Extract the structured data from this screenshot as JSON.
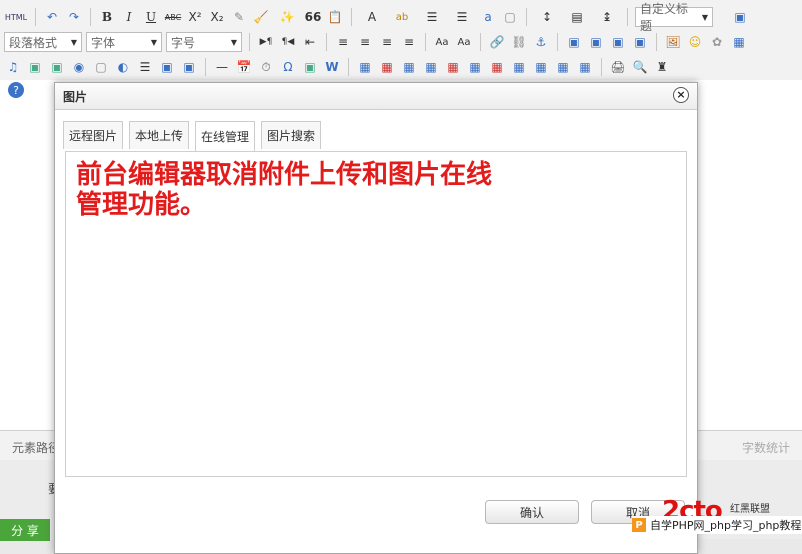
{
  "toolbar": {
    "row1": [
      "HTML",
      "↶",
      "↷",
      "B",
      "I",
      "U",
      "ABC",
      "X²",
      "X₂",
      "✎",
      "🧹",
      "✨",
      "66",
      "📋",
      "A",
      "ab",
      "☰",
      "☰",
      "a",
      "▢",
      "↕",
      "▤",
      "↨"
    ],
    "heading_select": "自定义标题",
    "paragraph_select": "段落格式",
    "font_select": "字体",
    "size_select": "字号",
    "row2": [
      "▶¶",
      "¶◀",
      "⇤",
      "≡",
      "≡",
      "≡",
      "≡",
      "Aa",
      "Aa",
      "🔗",
      "⛓",
      "⚓",
      "▣",
      "▣",
      "▣",
      "▣",
      "🖼",
      "☺",
      "✿",
      "▦"
    ],
    "row3": [
      "♫",
      "▣",
      "▣",
      "◉",
      "▢",
      "◐",
      "☰",
      "▣",
      "▣",
      "—",
      "📅",
      "⏱",
      "Ω",
      "▣",
      "W",
      "▦",
      "▦",
      "▦",
      "▦",
      "▦",
      "▦",
      "▦",
      "▦",
      "▦",
      "▦",
      "▦",
      "🖨",
      "🔍",
      "♜"
    ],
    "help": "?"
  },
  "statusbar": {
    "path_label": "元素路径",
    "word_count_label": "字数统计"
  },
  "below": {
    "clipped_text": "要",
    "share_label": "分 享"
  },
  "dialog": {
    "title": "图片",
    "close_glyph": "×",
    "tabs": [
      {
        "label": "远程图片",
        "active": false
      },
      {
        "label": "本地上传",
        "active": false
      },
      {
        "label": "在线管理",
        "active": true
      },
      {
        "label": "图片搜索",
        "active": false
      }
    ],
    "overlay_text": "前台编辑器取消附件上传和图片在线\n管理功能。",
    "ok_label": "确认",
    "cancel_label": "取消"
  },
  "watermark": {
    "logo_text": "2cto",
    "logo_side": "红黑联盟",
    "strip_text": "自学PHP网_php学习_php教程",
    "badge": "P"
  },
  "colors": {
    "accent_red": "#e31b1b",
    "share_green": "#4aa53a",
    "help_blue": "#3a73c7"
  }
}
